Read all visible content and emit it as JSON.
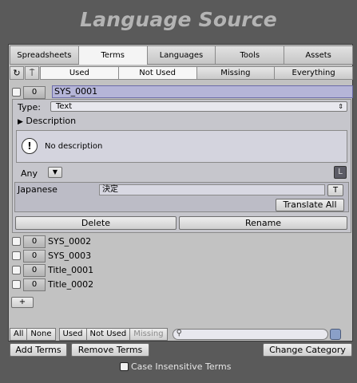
{
  "window": {
    "title": "Language Source"
  },
  "tabs": [
    {
      "label": "Spreadsheets"
    },
    {
      "label": "Terms"
    },
    {
      "label": "Languages"
    },
    {
      "label": "Tools"
    },
    {
      "label": "Assets"
    }
  ],
  "active_tab": "Terms",
  "filter_bar": {
    "refresh_icon": "↻",
    "pin_icon": "⍑",
    "buttons": [
      {
        "label": "Used"
      },
      {
        "label": "Not Used"
      },
      {
        "label": "Missing"
      },
      {
        "label": "Everything"
      }
    ]
  },
  "terms": [
    {
      "name": "SYS_0001",
      "count": "0",
      "selected": true
    },
    {
      "name": "SYS_0002",
      "count": "0"
    },
    {
      "name": "SYS_0003",
      "count": "0"
    },
    {
      "name": "Title_0001",
      "count": "0"
    },
    {
      "name": "Title_0002",
      "count": "0"
    }
  ],
  "detail": {
    "type_label": "Type:",
    "type_value": "Text",
    "description_label": "Description",
    "description_text": "No description",
    "any_label": "Any",
    "l_label": "L",
    "language": {
      "name": "Japanese",
      "value": "決定",
      "t_label": "T"
    },
    "translate_all_label": "Translate All",
    "delete_label": "Delete",
    "rename_label": "Rename"
  },
  "add_label": "+",
  "bottom_filter": {
    "all_label": "All",
    "none_label": "None",
    "used_label": "Used",
    "not_used_label": "Not Used",
    "missing_label": "Missing"
  },
  "buttons": {
    "add_terms": "Add Terms",
    "remove_terms": "Remove Terms",
    "change_category": "Change Category"
  },
  "case_insensitive_label": "Case Insensitive Terms"
}
